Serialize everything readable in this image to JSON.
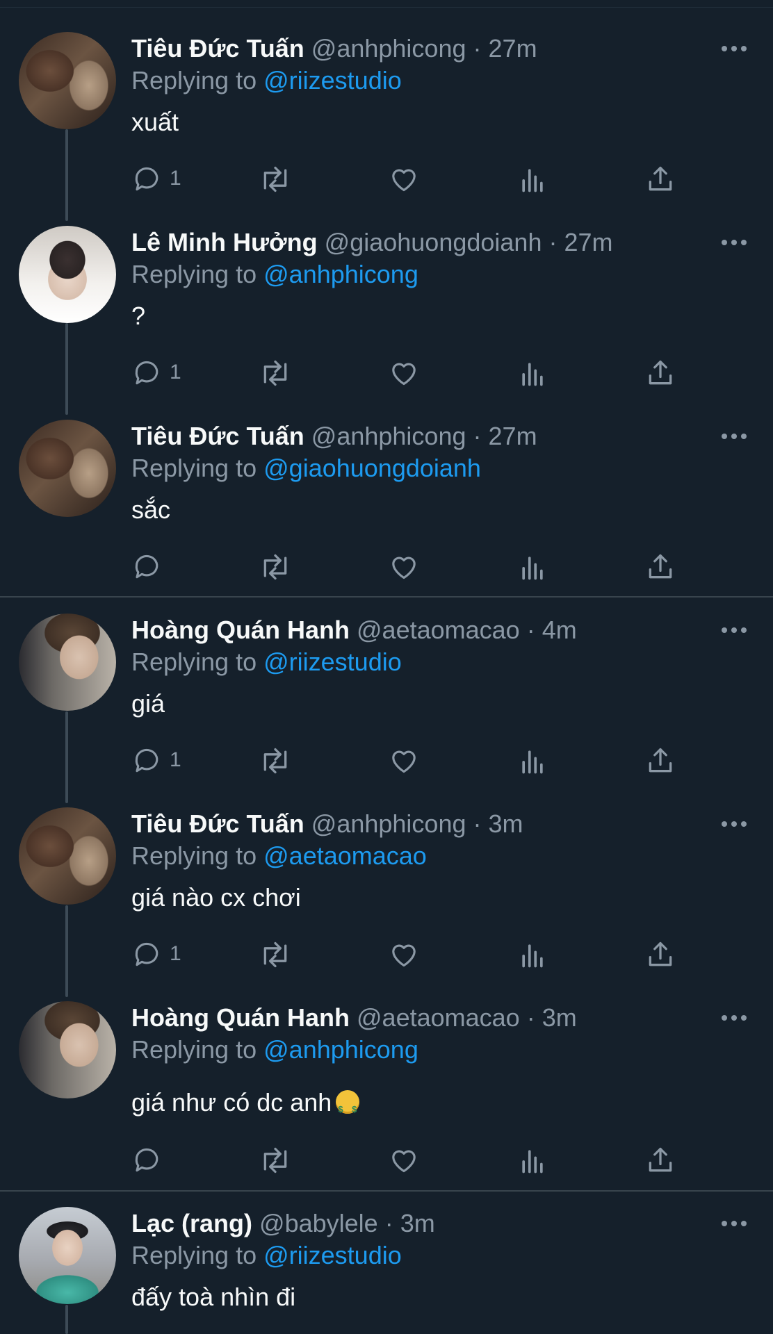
{
  "colors": {
    "background": "#15202b",
    "link": "#1d9bf0",
    "muted": "#8b98a5",
    "text": "#f7f9f9"
  },
  "tweets": [
    {
      "name": "Tiêu Đức Tuấn",
      "handle": "@anhphicong",
      "sep": "·",
      "time": "27m",
      "replying_prefix": "Replying to",
      "replying_handle": "@riizestudio",
      "text": "xuất",
      "reply_count": "1",
      "avatar": "avatar-tuan"
    },
    {
      "name": "Lê Minh Hưởng",
      "handle": "@giaohuongdoianh",
      "sep": "·",
      "time": "27m",
      "replying_prefix": "Replying to",
      "replying_handle": "@anhphicong",
      "text": "?",
      "reply_count": "1",
      "avatar": "avatar-huong"
    },
    {
      "name": "Tiêu Đức Tuấn",
      "handle": "@anhphicong",
      "sep": "·",
      "time": "27m",
      "replying_prefix": "Replying to",
      "replying_handle": "@giaohuongdoianh",
      "text": "sắc",
      "reply_count": "",
      "avatar": "avatar-tuan"
    },
    {
      "name": "Hoàng Quán Hanh",
      "handle": "@aetaomacao",
      "sep": "·",
      "time": "4m",
      "replying_prefix": "Replying to",
      "replying_handle": "@riizestudio",
      "text": "giá",
      "reply_count": "1",
      "avatar": "avatar-hanh"
    },
    {
      "name": "Tiêu Đức Tuấn",
      "handle": "@anhphicong",
      "sep": "·",
      "time": "3m",
      "replying_prefix": "Replying to",
      "replying_handle": "@aetaomacao",
      "text": "giá nào cx chơi",
      "reply_count": "1",
      "avatar": "avatar-tuan"
    },
    {
      "name": "Hoàng Quán Hanh",
      "handle": "@aetaomacao",
      "sep": "·",
      "time": "3m",
      "replying_prefix": "Replying to",
      "replying_handle": "@anhphicong",
      "text": "giá như có dc anh",
      "emoji": "money-mouth-face-emoji",
      "reply_count": "",
      "avatar": "avatar-hanh"
    },
    {
      "name": "Lạc (rang)",
      "handle": "@babylele",
      "sep": "·",
      "time": "3m",
      "replying_prefix": "Replying to",
      "replying_handle": "@riizestudio",
      "text": "đấy toà nhìn đi",
      "reply_count": "",
      "avatar": "avatar-lac"
    }
  ]
}
